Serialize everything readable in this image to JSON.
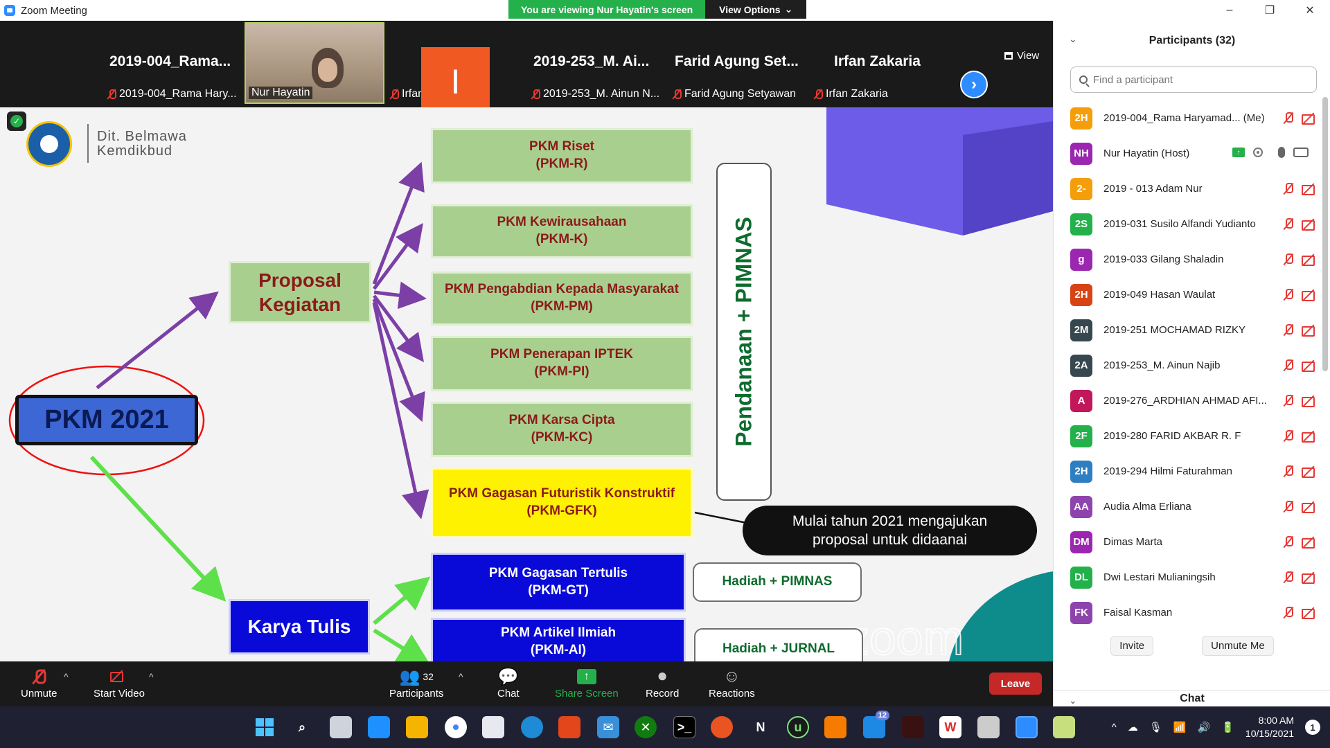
{
  "window": {
    "title": "Zoom Meeting",
    "controls": [
      "–",
      "❐",
      "✕"
    ]
  },
  "banner": {
    "viewing_text": "You are viewing Nur Hayatin's screen",
    "view_options_label": "View Options"
  },
  "video_strip": {
    "tiles": [
      {
        "big_name": "2019-004_Rama...",
        "foot_name": "2019-004_Rama Hary...",
        "muted": true
      },
      {
        "big_name": "",
        "foot_name": "Nur Hayatin",
        "muted": false
      },
      {
        "big_name": "I",
        "foot_name": "Irfan",
        "muted": true
      },
      {
        "big_name": "2019-253_M. Ai...",
        "foot_name": "2019-253_M. Ainun N...",
        "muted": true
      },
      {
        "big_name": "Farid Agung Set...",
        "foot_name": "Farid Agung Setyawan",
        "muted": true
      },
      {
        "big_name": "Irfan Zakaria",
        "foot_name": "Irfan Zakaria",
        "muted": true
      }
    ],
    "view_label": "View"
  },
  "slide": {
    "logo_line1": "Dit. Belmawa",
    "logo_line2": "Kemdikbud",
    "pkm2021": "PKM 2021",
    "proposal_line1": "Proposal",
    "proposal_line2": "Kegiatan",
    "karya": "Karya Tulis",
    "pendanaan": "Pendanaan + PIMNAS",
    "callout_line1": "Mulai tahun 2021 mengajukan",
    "callout_line2": "proposal untuk didaanai",
    "boxes": [
      {
        "line1": "PKM Riset",
        "line2": "(PKM-R)"
      },
      {
        "line1": "PKM Kewirausahaan",
        "line2": "(PKM-K)"
      },
      {
        "line1": "PKM Pengabdian Kepada Masyarakat",
        "line2": "(PKM-PM)"
      },
      {
        "line1": "PKM Penerapan IPTEK",
        "line2": "(PKM-PI)"
      },
      {
        "line1": "PKM Karsa Cipta",
        "line2": "(PKM-KC)"
      },
      {
        "line1": "PKM Gagasan Futuristik Konstruktif",
        "line2": "(PKM-GFK)"
      },
      {
        "line1": "PKM Gagasan Tertulis",
        "line2": "(PKM-GT)"
      },
      {
        "line1": "PKM Artikel Ilmiah",
        "line2": "(PKM-AI)"
      }
    ],
    "hadiah_pimnas": "Hadiah + PIMNAS",
    "hadiah_jurnal": "Hadiah + JURNAL",
    "watermark": "zoom"
  },
  "toolbar": {
    "unmute": "Unmute",
    "start_video": "Start Video",
    "participants": "Participants",
    "participant_count": "32",
    "chat": "Chat",
    "share_screen": "Share Screen",
    "record": "Record",
    "reactions": "Reactions",
    "leave": "Leave"
  },
  "panel": {
    "title": "Participants (32)",
    "search_placeholder": "Find a participant",
    "participants": [
      {
        "initials": "2H",
        "name": "2019-004_Rama Haryamad... (Me)",
        "color": "#f59e0b"
      },
      {
        "initials": "NH",
        "name": "Nur Hayatin (Host)",
        "color": "#9b27b0"
      },
      {
        "initials": "2-",
        "name": "2019 - 013 Adam Nur",
        "color": "#f59e0b"
      },
      {
        "initials": "2S",
        "name": "2019-031 Susilo Alfandi Yudianto",
        "color": "#24b04b"
      },
      {
        "initials": "g",
        "name": "2019-033 Gilang Shaladin",
        "color": "#9b27b0"
      },
      {
        "initials": "2H",
        "name": "2019-049 Hasan Waulat",
        "color": "#d84315"
      },
      {
        "initials": "2M",
        "name": "2019-251 MOCHAMAD RIZKY",
        "color": "#37474f"
      },
      {
        "initials": "2A",
        "name": "2019-253_M. Ainun Najib",
        "color": "#37474f"
      },
      {
        "initials": "A",
        "name": "2019-276_ARDHIAN AHMAD AFI...",
        "color": "#c2185b"
      },
      {
        "initials": "2F",
        "name": "2019-280 FARID AKBAR R. F",
        "color": "#24b04b"
      },
      {
        "initials": "2H",
        "name": "2019-294 Hilmi Faturahman",
        "color": "#2d7fc1"
      },
      {
        "initials": "AA",
        "name": "Audia Alma Erliana",
        "color": "#8e44ad"
      },
      {
        "initials": "DM",
        "name": "Dimas Marta",
        "color": "#9b27b0"
      },
      {
        "initials": "DL",
        "name": "Dwi Lestari Mulianingsih",
        "color": "#24b04b"
      },
      {
        "initials": "FK",
        "name": "Faisal Kasman",
        "color": "#8e44ad"
      }
    ],
    "invite": "Invite",
    "unmute_me": "Unmute Me",
    "chat_title": "Chat"
  },
  "taskbar": {
    "time": "8:00 AM",
    "date": "10/15/2021",
    "notification_count": "1",
    "badge_count": "12"
  }
}
